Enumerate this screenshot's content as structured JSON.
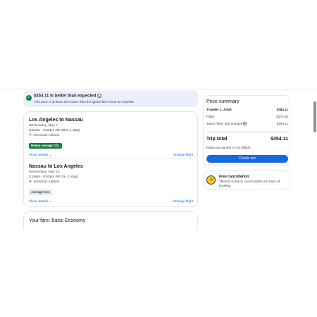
{
  "banner": {
    "title": "$354.11 is better than expected",
    "subtitle": "This price is at least 45% lower than the typical fare found on Expedia"
  },
  "legs": [
    {
      "route": "Los Angeles to Nassau",
      "date": "Wednesday, May 7",
      "times": "6:04am - 5:50pm (9h 46m, 1 stop)",
      "airline": "American Airlines",
      "badge": "Below average CO₂",
      "show_details": "Show details",
      "change": "Change flight"
    },
    {
      "route": "Nassau to Los Angeles",
      "date": "Wednesday, May 14",
      "times": "2:45pm - 8:52pm (9h 7m, 1 stop)",
      "airline": "American Airlines",
      "badge": "Average CO₂",
      "show_details": "Show details",
      "change": "Change flight"
    }
  ],
  "fare": {
    "title": "Your fare: Basic Economy"
  },
  "price_summary": {
    "title": "Price summary",
    "traveler_label": "Traveler 1: Adult",
    "traveler_value": "$354.11",
    "flight_label": "Flight",
    "flight_value": "$170.00",
    "taxes_label": "Taxes, fees, and charges",
    "taxes_value": "$184.11",
    "total_label": "Trip total",
    "total_value": "$354.11",
    "note": "Rates are quoted in US dollars.",
    "checkout": "Check out"
  },
  "cancellation": {
    "title": "Free cancellation",
    "desc": "There's no fee to cancel within 24 hours of booking."
  },
  "colors": {
    "accent": "#1668e3",
    "badge_green": "#1c7a3f",
    "banner_bg": "#eaf0f9"
  }
}
